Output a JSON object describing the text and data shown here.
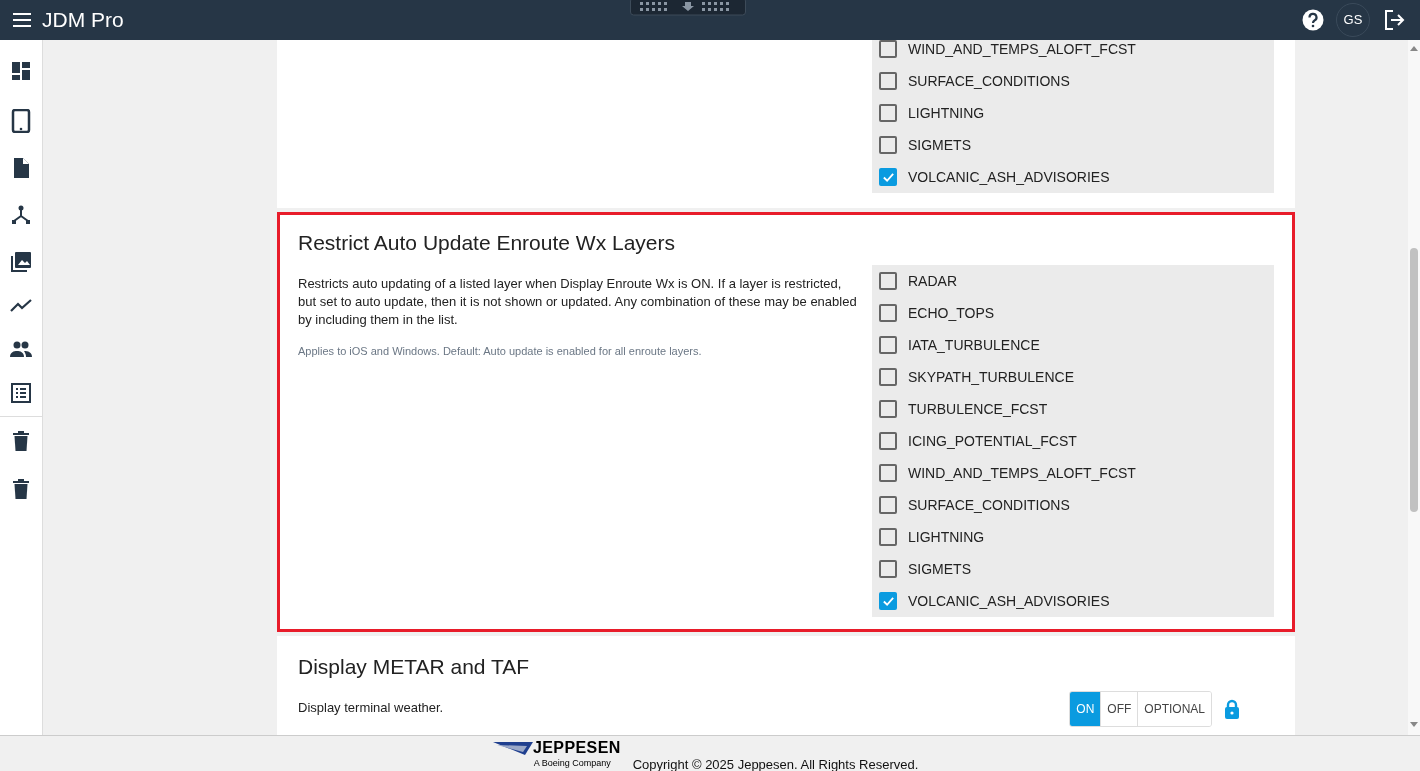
{
  "header": {
    "title": "JDM Pro",
    "avatar": "GS"
  },
  "sections": [
    {
      "kind": "checklist",
      "highlighted": false,
      "options": [
        {
          "label": "WIND_AND_TEMPS_ALOFT_FCST",
          "checked": false
        },
        {
          "label": "SURFACE_CONDITIONS",
          "checked": false
        },
        {
          "label": "LIGHTNING",
          "checked": false
        },
        {
          "label": "SIGMETS",
          "checked": false
        },
        {
          "label": "VOLCANIC_ASH_ADVISORIES",
          "checked": true
        }
      ]
    },
    {
      "kind": "checklist",
      "highlighted": true,
      "title": "Restrict Auto Update Enroute Wx Layers",
      "description": "Restricts auto updating of a listed layer when Display Enroute Wx is ON. If a layer is restricted, but set to auto update, then it is not shown or updated. Any combination of these may be enabled by including them in the list.",
      "note": "Applies to iOS and Windows. Default: Auto update is enabled for all enroute layers.",
      "options": [
        {
          "label": "RADAR",
          "checked": false
        },
        {
          "label": "ECHO_TOPS",
          "checked": false
        },
        {
          "label": "IATA_TURBULENCE",
          "checked": false
        },
        {
          "label": "SKYPATH_TURBULENCE",
          "checked": false
        },
        {
          "label": "TURBULENCE_FCST",
          "checked": false
        },
        {
          "label": "ICING_POTENTIAL_FCST",
          "checked": false
        },
        {
          "label": "WIND_AND_TEMPS_ALOFT_FCST",
          "checked": false
        },
        {
          "label": "SURFACE_CONDITIONS",
          "checked": false
        },
        {
          "label": "LIGHTNING",
          "checked": false
        },
        {
          "label": "SIGMETS",
          "checked": false
        },
        {
          "label": "VOLCANIC_ASH_ADVISORIES",
          "checked": true
        }
      ]
    },
    {
      "kind": "toggle",
      "highlighted": false,
      "title": "Display METAR and TAF",
      "description": "Display terminal weather.",
      "locked": true,
      "options": [
        {
          "label": "ON",
          "selected": true
        },
        {
          "label": "OFF",
          "selected": false
        },
        {
          "label": "OPTIONAL",
          "selected": false
        }
      ]
    }
  ],
  "footer": {
    "logo_name": "JEPPESEN",
    "logo_tagline": "A Boeing Company",
    "copyright": "Copyright © 2025 Jeppesen. All Rights Reserved."
  }
}
